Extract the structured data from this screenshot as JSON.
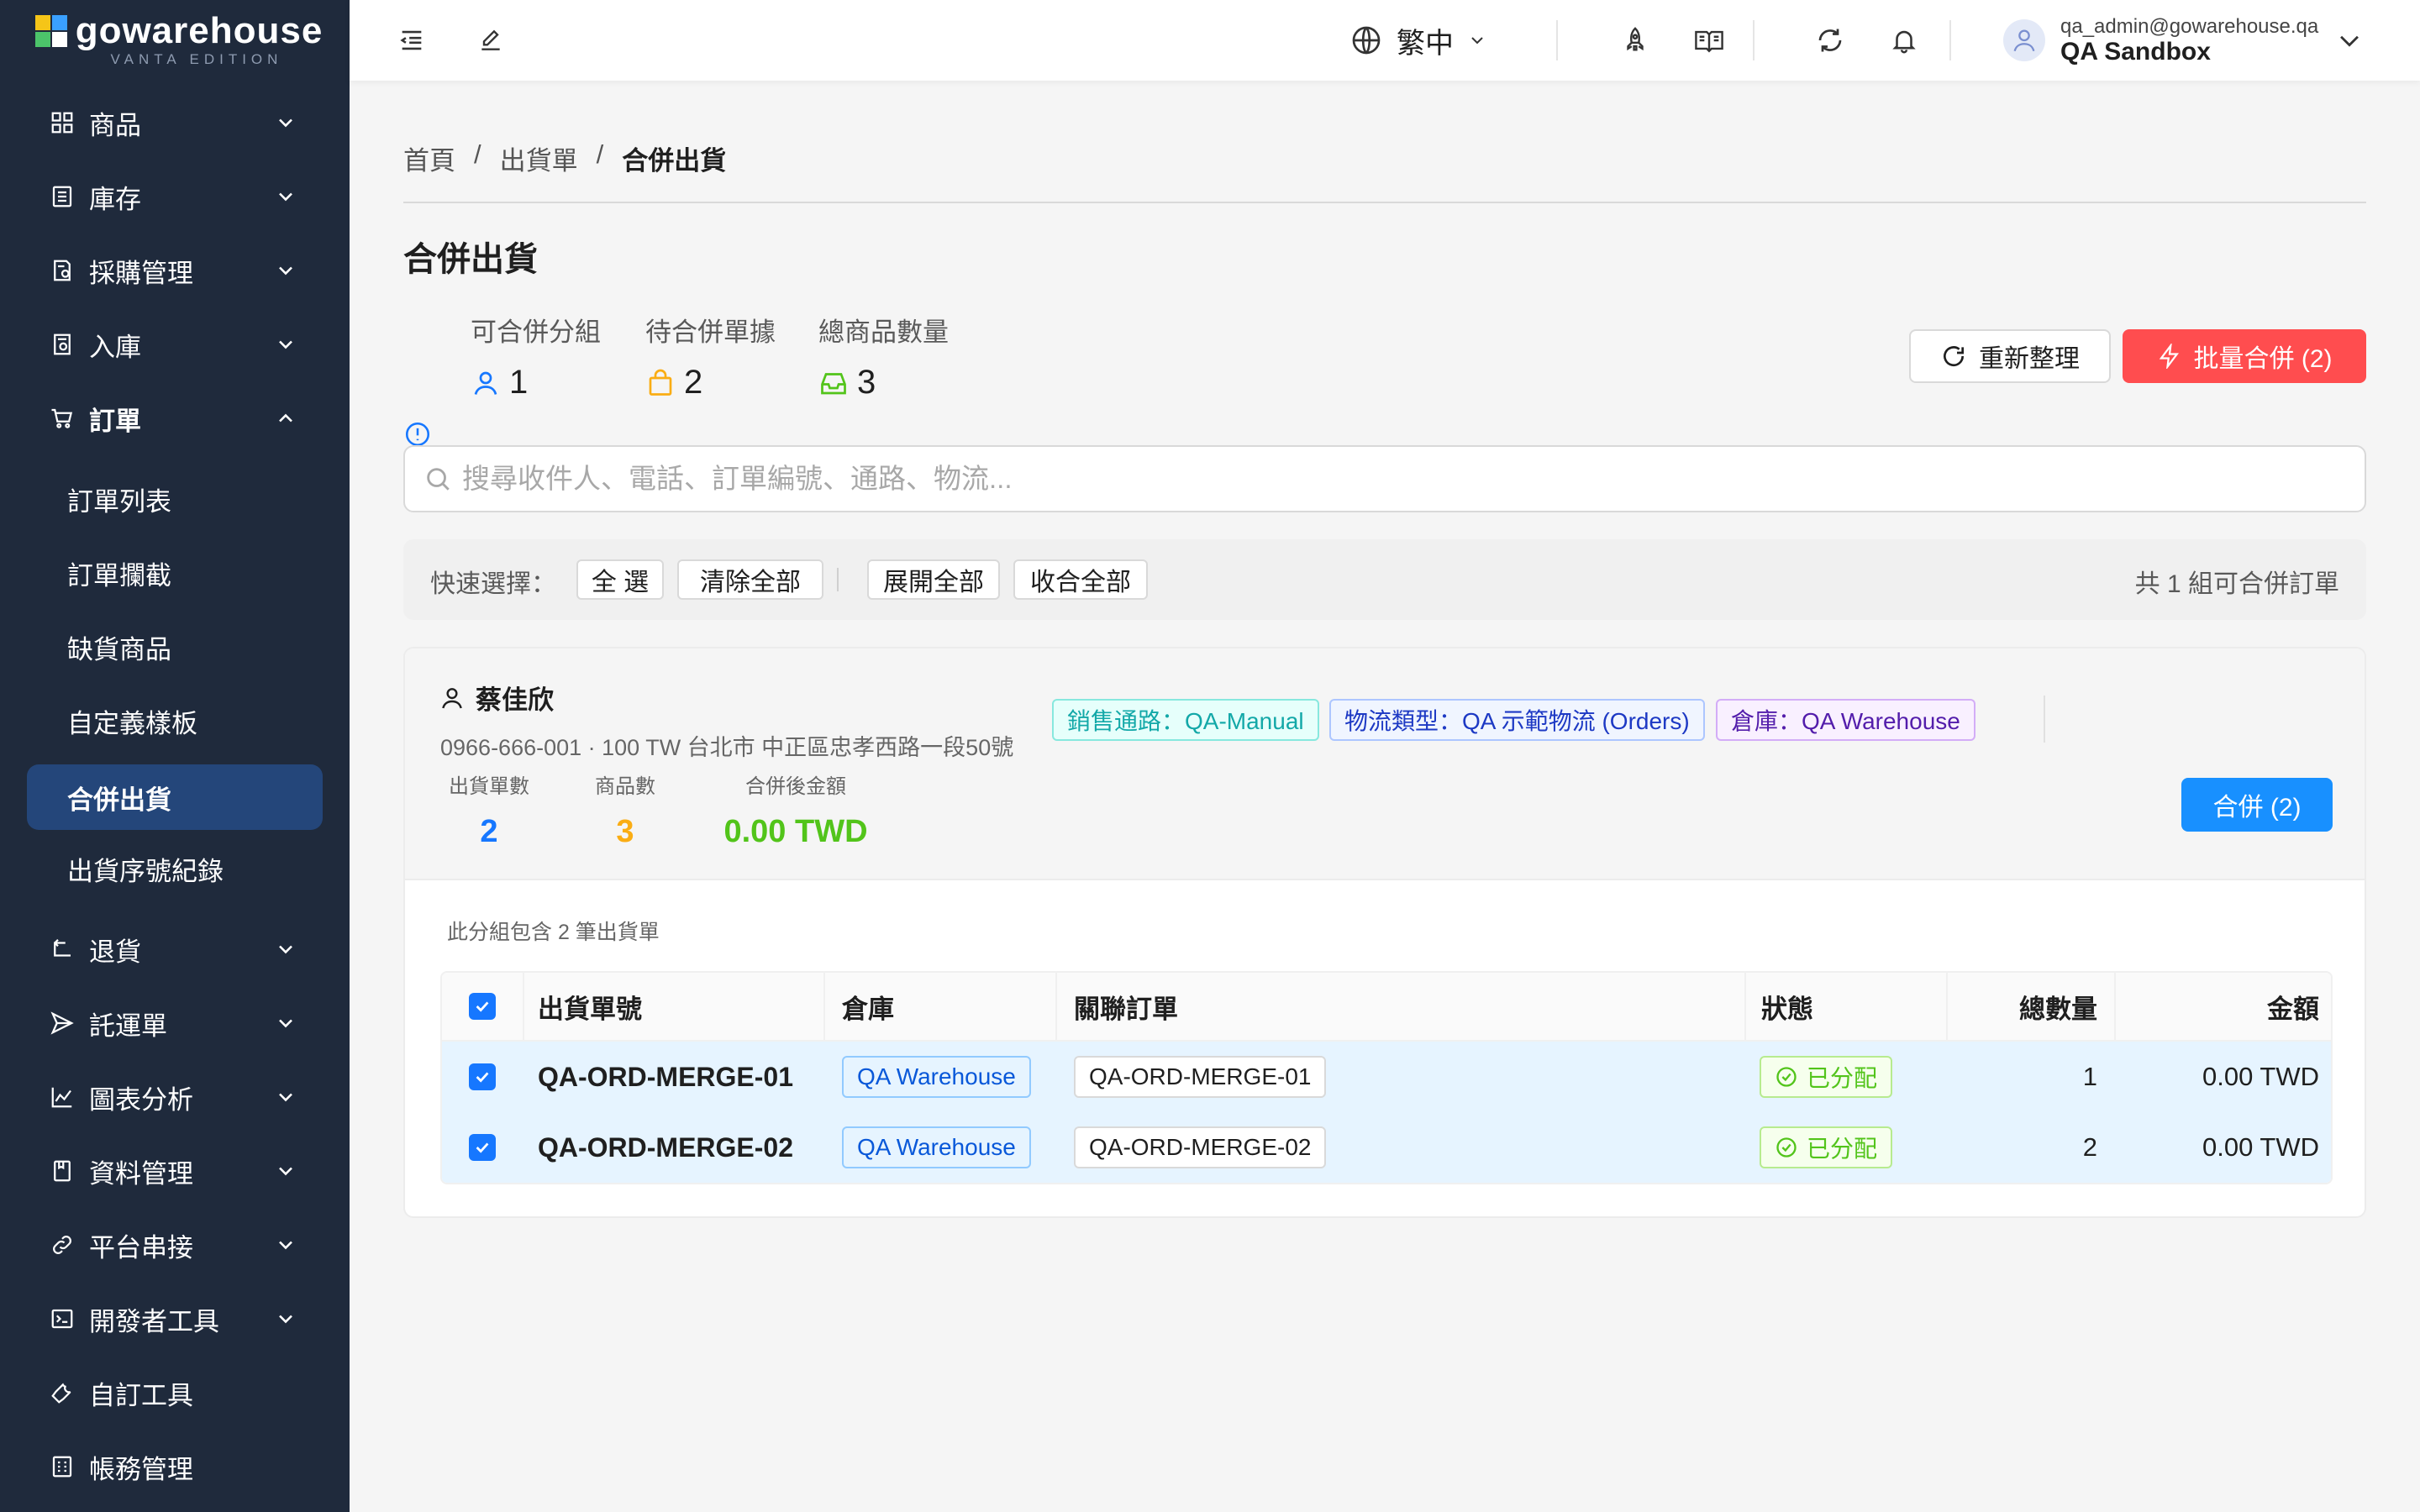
{
  "app": {
    "logo_text": "gowarehouse",
    "logo_sub": "VANTA EDITION"
  },
  "sidebar": {
    "items": [
      {
        "label": "商品",
        "icon": "grid-icon"
      },
      {
        "label": "庫存",
        "icon": "inventory-icon"
      },
      {
        "label": "採購管理",
        "icon": "purchase-icon"
      },
      {
        "label": "入庫",
        "icon": "inbound-icon"
      },
      {
        "label": "訂單",
        "icon": "cart-icon"
      },
      {
        "label": "訂單列表"
      },
      {
        "label": "訂單攔截"
      },
      {
        "label": "缺貨商品"
      },
      {
        "label": "自定義樣板"
      },
      {
        "label": "合併出貨"
      },
      {
        "label": "出貨序號紀錄"
      },
      {
        "label": "退貨",
        "icon": "return-icon"
      },
      {
        "label": "託運單",
        "icon": "send-icon"
      },
      {
        "label": "圖表分析",
        "icon": "chart-icon"
      },
      {
        "label": "資料管理",
        "icon": "data-icon"
      },
      {
        "label": "平台串接",
        "icon": "link-icon"
      },
      {
        "label": "開發者工具",
        "icon": "terminal-icon"
      },
      {
        "label": "自訂工具",
        "icon": "wrench-icon"
      },
      {
        "label": "帳務管理",
        "icon": "billing-icon"
      }
    ]
  },
  "header": {
    "language": "繁中",
    "user_email": "qa_admin@gowarehouse.qa",
    "user_name": "QA Sandbox"
  },
  "breadcrumb": [
    "首頁",
    "出貨單",
    "合併出貨"
  ],
  "breadcrumb_sep": "/",
  "page": {
    "title": "合併出貨"
  },
  "stats": [
    {
      "label": "可合併分組",
      "value": "1",
      "icon": "user-icon",
      "color": "#1677ff"
    },
    {
      "label": "待合併單據",
      "value": "2",
      "icon": "shopping-bag-icon",
      "color": "#faad14"
    },
    {
      "label": "總商品數量",
      "value": "3",
      "icon": "inbox-icon",
      "color": "#52c41a"
    }
  ],
  "actions": {
    "refresh": "重新整理",
    "batch_merge": "批量合併 (2)"
  },
  "search": {
    "placeholder": "搜尋收件人、電話、訂單編號、通路、物流..."
  },
  "quick": {
    "label": "快速選擇：",
    "select_all": "全 選",
    "clear_all": "清除全部",
    "expand_all": "展開全部",
    "collapse_all": "收合全部",
    "summary": "共 1 組可合併訂單"
  },
  "group": {
    "recipient": "蔡佳欣",
    "address": "0966-666-001 · 100 TW 台北市 中正區忠孝西路一段50號",
    "tags": {
      "channel": "銷售通路：QA-Manual",
      "logistics": "物流類型：QA 示範物流 (Orders)",
      "warehouse": "倉庫：QA Warehouse"
    },
    "stats": [
      {
        "label": "出貨單數",
        "value": "2",
        "color": "#1677ff"
      },
      {
        "label": "商品數",
        "value": "3",
        "color": "#faad14"
      },
      {
        "label": "合併後金額",
        "value": "0.00 TWD",
        "color": "#52c41a"
      }
    ],
    "merge_button": "合併 (2)",
    "note": "此分組包含 2 筆出貨單"
  },
  "table": {
    "headers": [
      "出貨單號",
      "倉庫",
      "關聯訂單",
      "狀態",
      "總數量",
      "金額"
    ],
    "rows": [
      {
        "id": "QA-ORD-MERGE-01",
        "warehouse": "QA Warehouse",
        "order": "QA-ORD-MERGE-01",
        "status": "已分配",
        "qty": "1",
        "amount": "0.00 TWD"
      },
      {
        "id": "QA-ORD-MERGE-02",
        "warehouse": "QA Warehouse",
        "order": "QA-ORD-MERGE-02",
        "status": "已分配",
        "qty": "2",
        "amount": "0.00 TWD"
      }
    ]
  }
}
